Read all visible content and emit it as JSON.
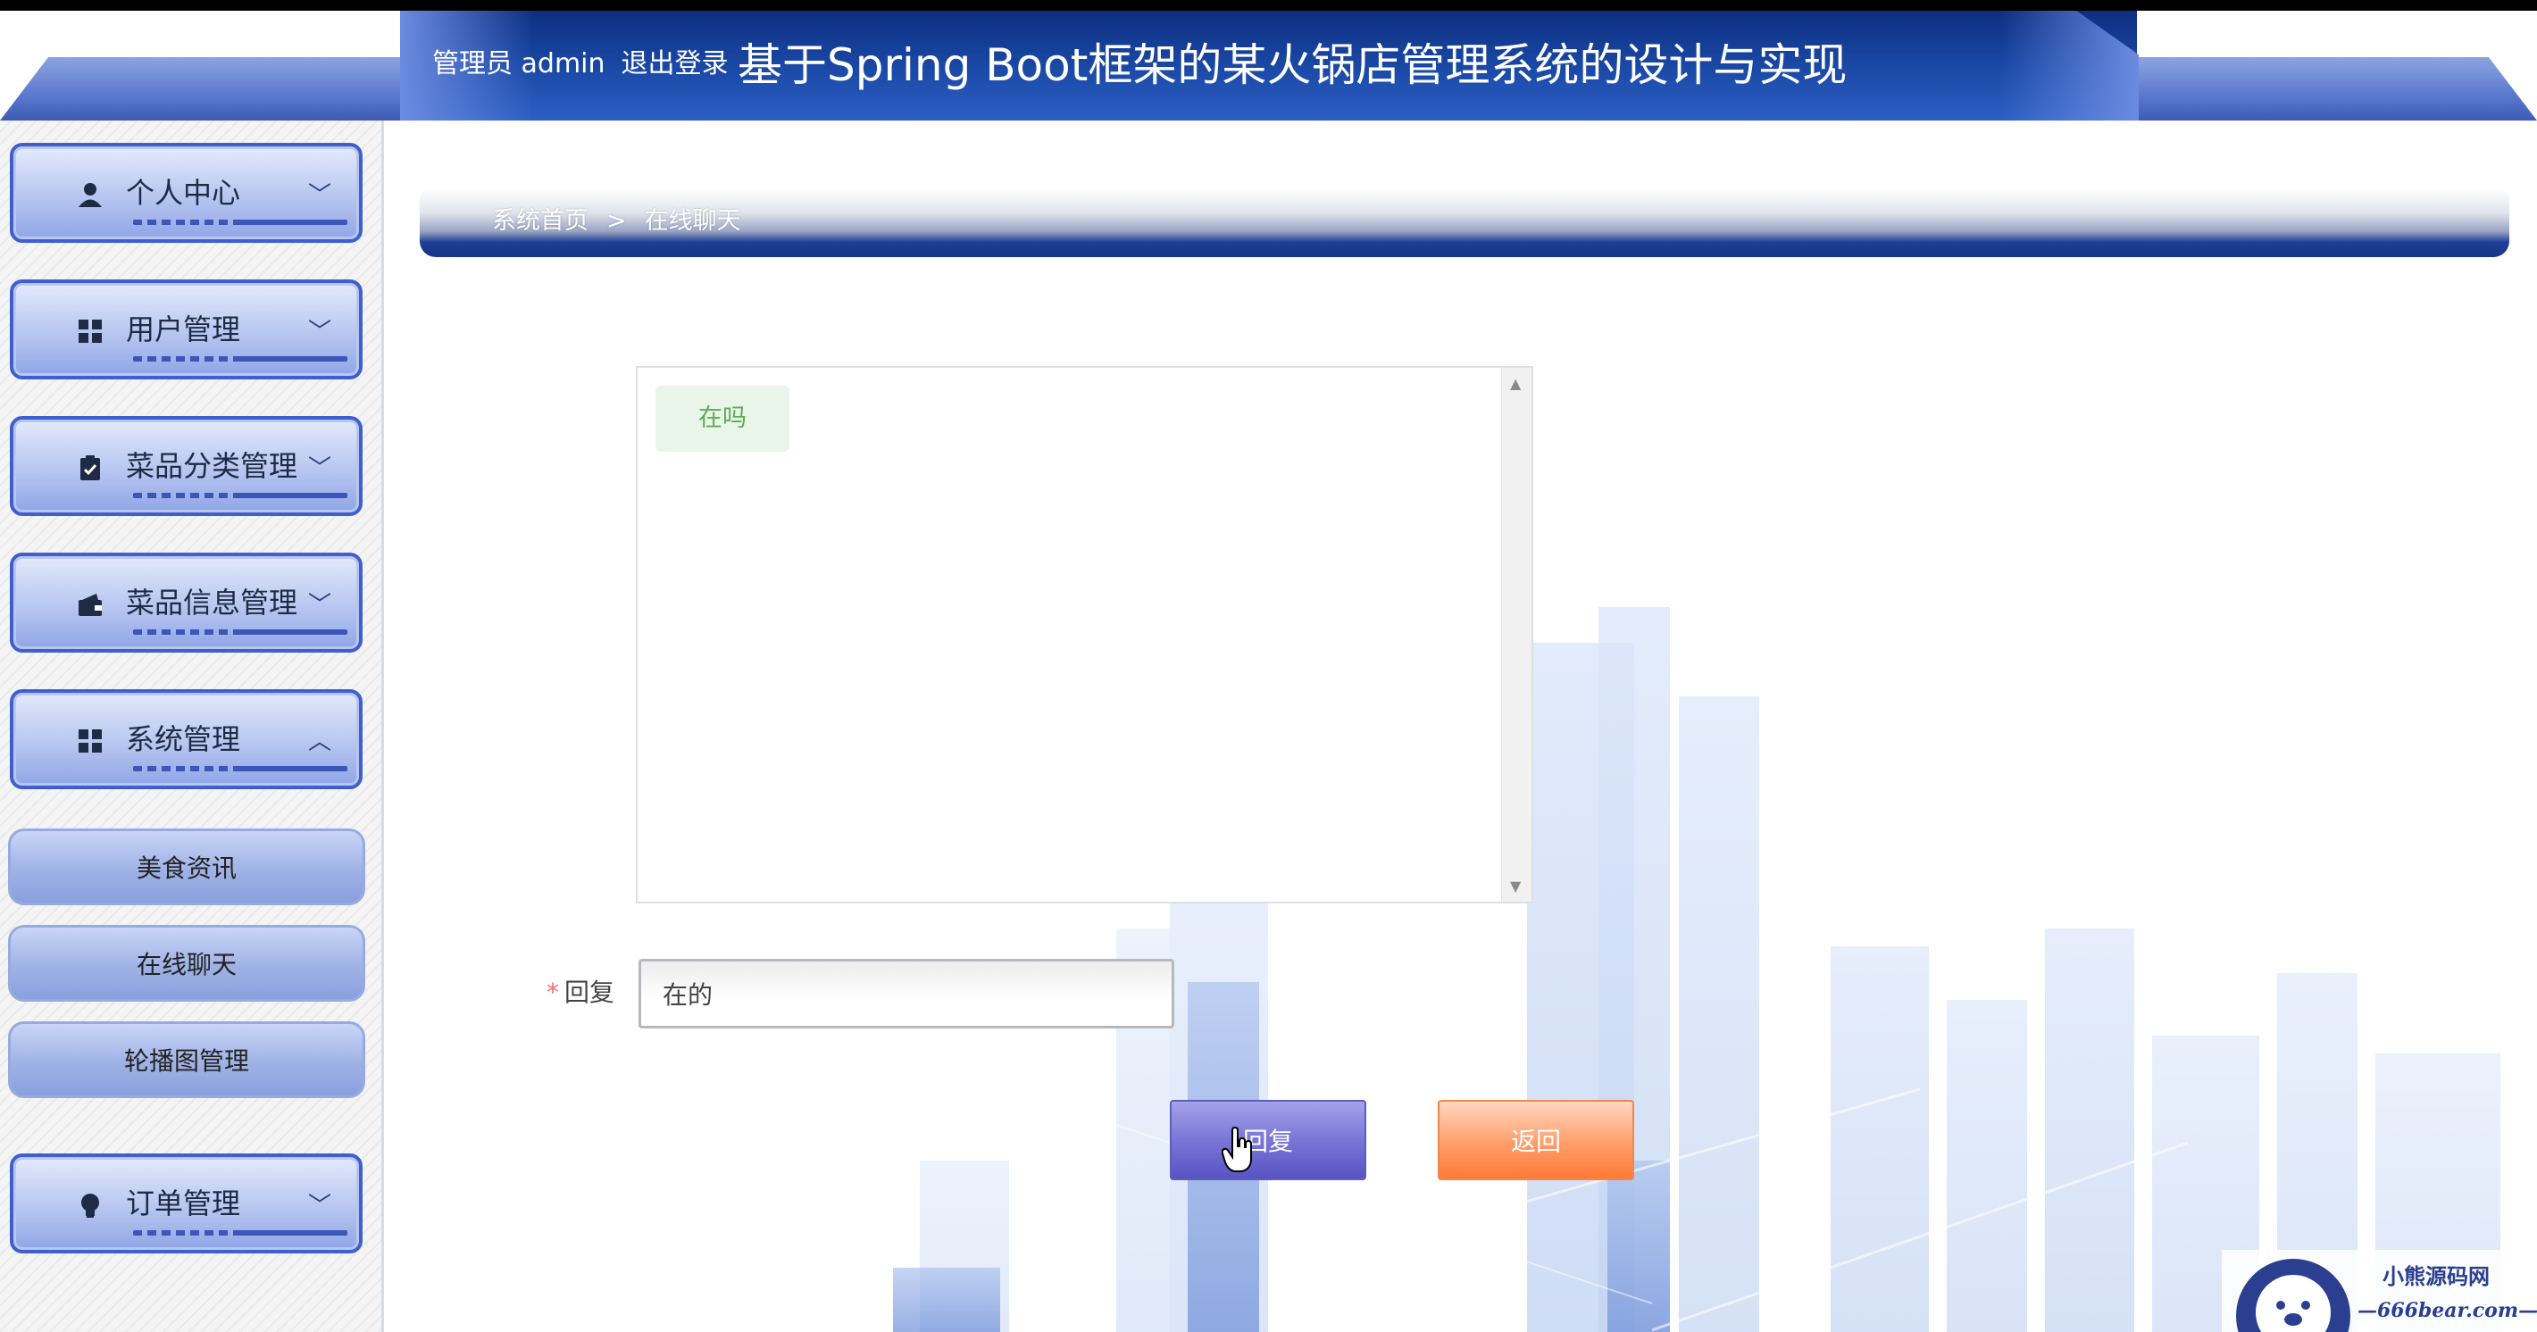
{
  "header": {
    "role_label": "管理员 admin",
    "logout_label": "退出登录",
    "app_title": "基于Spring Boot框架的某火锅店管理系统的设计与实现"
  },
  "sidebar": {
    "groups": [
      {
        "label": "个人中心",
        "icon": "user-icon",
        "expanded": false
      },
      {
        "label": "用户管理",
        "icon": "grid-icon",
        "expanded": false
      },
      {
        "label": "菜品分类管理",
        "icon": "clipboard-check-icon",
        "expanded": false
      },
      {
        "label": "菜品信息管理",
        "icon": "wallet-icon",
        "expanded": false
      },
      {
        "label": "系统管理",
        "icon": "grid-icon",
        "expanded": true
      },
      {
        "label": "订单管理",
        "icon": "lightbulb-icon",
        "expanded": false
      }
    ],
    "sub_items": [
      "美食资讯",
      "在线聊天",
      "轮播图管理"
    ]
  },
  "breadcrumb": {
    "home": "系统首页",
    "separator": ">",
    "current": "在线聊天"
  },
  "chat": {
    "messages": [
      {
        "text": "在吗"
      }
    ]
  },
  "reply_form": {
    "required_mark": "*",
    "label": "回复",
    "value": "在的"
  },
  "buttons": {
    "reply": "回复",
    "back": "返回"
  },
  "watermark": {
    "line1": "小熊源码网",
    "line2": "—666bear.com—"
  },
  "colors": {
    "header_blue": "#1b4aa8",
    "menu_border": "#3f5ed0",
    "reply_button": "#7a76d8",
    "back_button": "#ff7a36",
    "chat_bubble_text": "#5eab55"
  }
}
